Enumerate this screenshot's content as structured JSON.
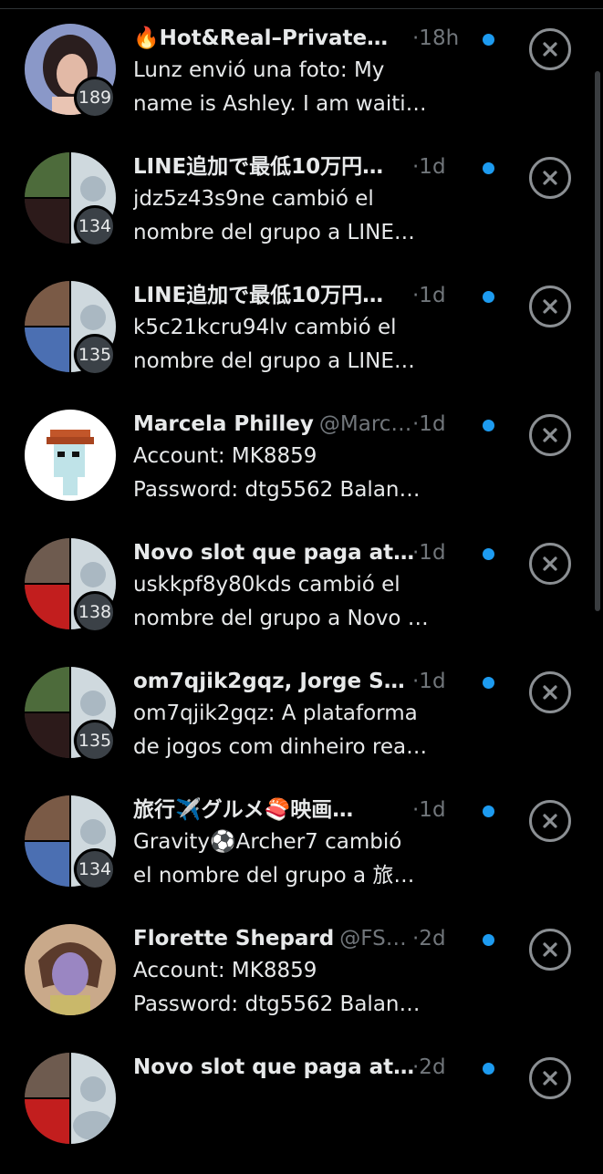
{
  "conversations": [
    {
      "name": "🔥Hot&Real–Private…",
      "handle": "",
      "time": "·18h",
      "line1": "Lunz envió una foto: My",
      "line2": "name is Ashley. I am waiti…",
      "badge": "189",
      "avatar_type": "person",
      "unread": true
    },
    {
      "name": "LINE追加で最低10万円…",
      "handle": "",
      "time": "·1d",
      "line1": "jdz5z43s9ne cambió el",
      "line2": "nombre del grupo a LINE…",
      "badge": "134",
      "avatar_type": "group",
      "unread": true
    },
    {
      "name": "LINE追加で最低10万円…",
      "handle": "",
      "time": "·1d",
      "line1": "k5c21kcru94lv cambió el",
      "line2": "nombre del grupo a LINE…",
      "badge": "135",
      "avatar_type": "group",
      "unread": true
    },
    {
      "name": "Marcela Philley",
      "handle": "@Marc…",
      "time": "·1d",
      "line1": "Account: MK8859",
      "line2": "Password: dtg5562 Balan…",
      "badge": "",
      "avatar_type": "pixel",
      "unread": true
    },
    {
      "name": "Novo slot que paga at…",
      "handle": "",
      "time": "·1d",
      "line1": "uskkpf8y80kds cambió el",
      "line2": "nombre del grupo a Novo …",
      "badge": "138",
      "avatar_type": "group",
      "unread": true
    },
    {
      "name": "om7qjik2gqz, Jorge Su…",
      "handle": "",
      "time": "·1d",
      "line1": "om7qjik2gqz: A plataforma",
      "line2": "de jogos com dinheiro rea…",
      "badge": "135",
      "avatar_type": "group",
      "unread": true
    },
    {
      "name": "旅行✈️グルメ🍣映画…",
      "handle": "",
      "time": "·1d",
      "line1": "Gravity⚽Archer7 cambió",
      "line2": "el nombre del grupo a 旅…",
      "badge": "134",
      "avatar_type": "group",
      "unread": true
    },
    {
      "name": "Florette Shepard",
      "handle": "@FS…",
      "time": "·2d",
      "line1": "Account: MK8859",
      "line2": "Password: dtg5562 Balan…",
      "badge": "",
      "avatar_type": "drawn",
      "unread": true
    },
    {
      "name": "Novo slot que paga at…",
      "handle": "",
      "time": "·2d",
      "line1": "",
      "line2": "",
      "badge": "",
      "avatar_type": "group",
      "unread": true
    }
  ],
  "colors": {
    "background": "#000000",
    "text_primary": "#e7e9ea",
    "text_secondary": "#71767b",
    "unread_dot": "#1d9bf0",
    "badge_bg": "#3b4147"
  },
  "icons": {
    "close": "close-circle-icon"
  }
}
